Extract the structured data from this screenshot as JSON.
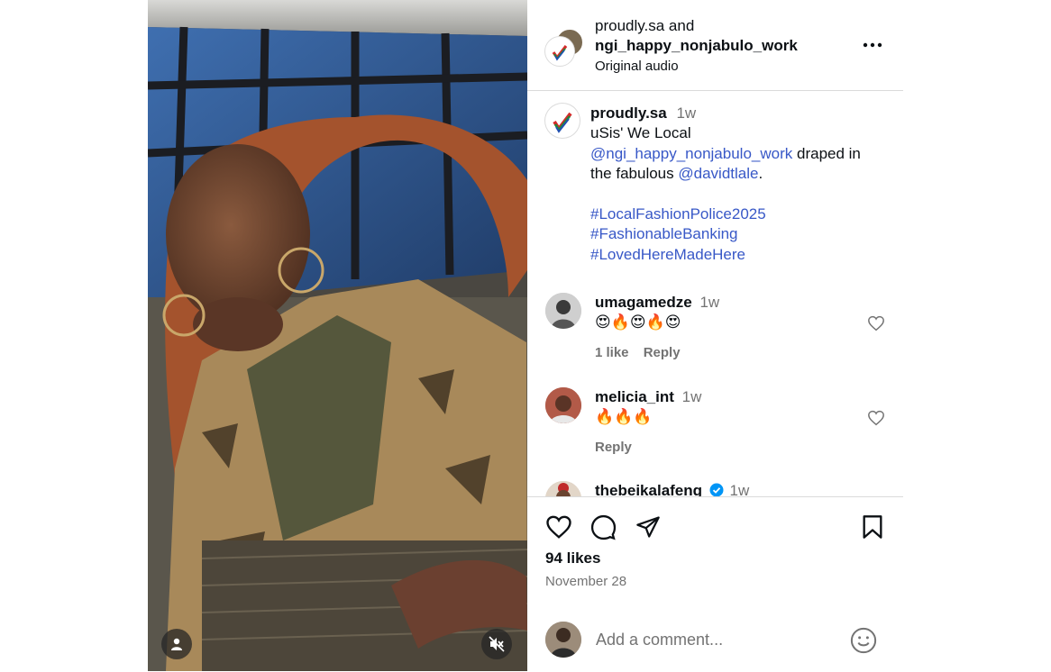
{
  "post": {
    "authors_first": "proudly.sa",
    "authors_and": "and",
    "authors_second": "ngi_happy_nonjabulo_work",
    "audio": "Original audio",
    "more_icon": "more-horizontal-icon"
  },
  "caption": {
    "username": "proudly.sa",
    "time": "1w",
    "line1": "uSis' We Local",
    "mention1": "@ngi_happy_nonjabulo_work",
    "text1": "draped in",
    "text2": "the fabulous",
    "mention2": "@davidtlale",
    "period": ".",
    "hashtags": [
      "#LocalFashionPolice2025",
      "#FashionableBanking",
      "#LovedHereMadeHere"
    ]
  },
  "comments": [
    {
      "username": "umagamedze",
      "time": "1w",
      "text": "😍🔥😍🔥😍",
      "likes": "1 like",
      "reply": "Reply"
    },
    {
      "username": "melicia_int",
      "time": "1w",
      "text": "🔥🔥🔥",
      "reply": "Reply"
    },
    {
      "username": "thebeikalafeng",
      "time": "1w"
    }
  ],
  "footer": {
    "likes": "94 likes",
    "date": "November 28",
    "comment_placeholder": "Add a comment..."
  },
  "colors": {
    "link": "#3858c7",
    "muted": "#737373",
    "border": "#dbdbdb",
    "verified": "#0095f6"
  }
}
